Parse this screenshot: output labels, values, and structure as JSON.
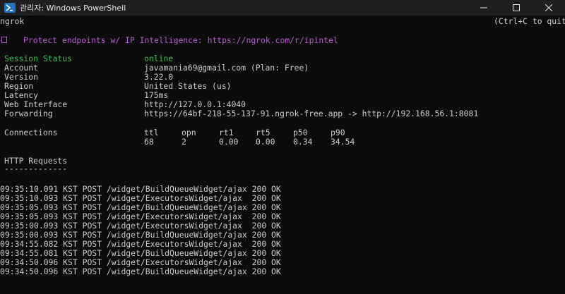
{
  "window": {
    "title": "관리자: Windows PowerShell",
    "controls": [
      "minimize",
      "maximize",
      "close"
    ]
  },
  "terminal": {
    "header_left": "ngrok",
    "header_right": "(Ctrl+C to quit)",
    "promo": "Protect endpoints w/ IP Intelligence: https://ngrok.com/r/ipintel",
    "status": [
      {
        "label": "Session Status",
        "value": "online"
      },
      {
        "label": "Account",
        "value": "javamania69@gmail.com (Plan: Free)"
      },
      {
        "label": "Version",
        "value": "3.22.0"
      },
      {
        "label": "Region",
        "value": "United States (us)"
      },
      {
        "label": "Latency",
        "value": "175ms"
      },
      {
        "label": "Web Interface",
        "value": "http://127.0.0.1:4040"
      },
      {
        "label": "Forwarding",
        "value": "https://64bf-218-55-137-91.ngrok-free.app -> http://192.168.56.1:8081"
      }
    ],
    "connections": {
      "label": "Connections",
      "headers": [
        "ttl",
        "opn",
        "rt1",
        "rt5",
        "p50",
        "p90"
      ],
      "values": [
        "68",
        "2",
        "0.00",
        "0.00",
        "0.34",
        "34.54"
      ]
    },
    "http_requests_title": "HTTP Requests",
    "http_requests_rule": "-------------",
    "requests": [
      "09:35:10.091 KST POST /widget/BuildQueueWidget/ajax 200 OK",
      "09:35:10.093 KST POST /widget/ExecutorsWidget/ajax  200 OK",
      "09:35:05.093 KST POST /widget/BuildQueueWidget/ajax 200 OK",
      "09:35:05.093 KST POST /widget/ExecutorsWidget/ajax  200 OK",
      "09:35:00.093 KST POST /widget/ExecutorsWidget/ajax  200 OK",
      "09:35:00.093 KST POST /widget/BuildQueueWidget/ajax 200 OK",
      "09:34:55.082 KST POST /widget/ExecutorsWidget/ajax  200 OK",
      "09:34:55.081 KST POST /widget/BuildQueueWidget/ajax 200 OK",
      "09:34:50.096 KST POST /widget/ExecutorsWidget/ajax  200 OK",
      "09:34:50.096 KST POST /widget/BuildQueueWidget/ajax 200 OK"
    ]
  },
  "colors": {
    "background": "#0c0c0c",
    "titlebar": "#1f1f1f",
    "text": "#cccccc",
    "online": "#3fb950",
    "promo": "#b45fd0"
  },
  "icons": {
    "app": "powershell-icon",
    "minimize": "minimize-icon",
    "maximize": "maximize-icon",
    "close": "close-icon"
  }
}
